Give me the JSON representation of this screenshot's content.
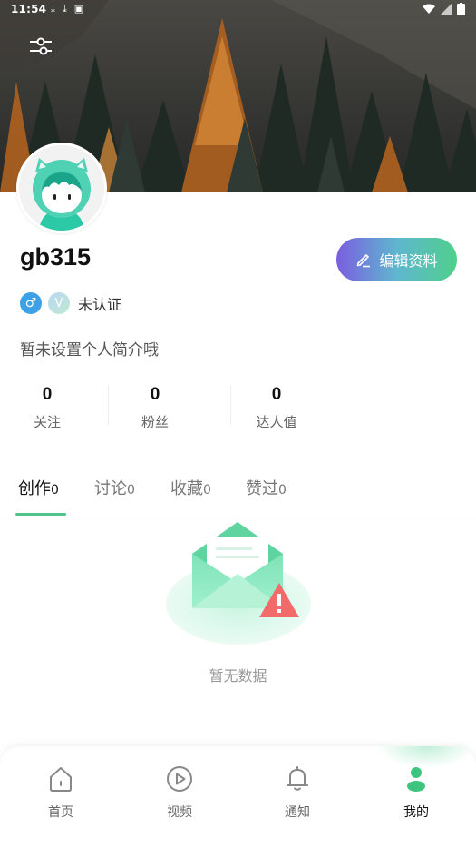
{
  "status_bar": {
    "time": "11:54"
  },
  "profile": {
    "username": "gb315",
    "gender_symbol": "♂",
    "verify_symbol": "V",
    "verify_status": "未认证",
    "bio": "暂未设置个人简介哦",
    "edit_button_label": "编辑资料"
  },
  "stats": [
    {
      "value": "0",
      "label": "关注"
    },
    {
      "value": "0",
      "label": "粉丝"
    },
    {
      "value": "0",
      "label": "达人值"
    }
  ],
  "tabs": [
    {
      "label": "创作",
      "count": "0",
      "active": true
    },
    {
      "label": "讨论",
      "count": "0",
      "active": false
    },
    {
      "label": "收藏",
      "count": "0",
      "active": false
    },
    {
      "label": "赞过",
      "count": "0",
      "active": false
    }
  ],
  "empty_state": {
    "text": "暂无数据"
  },
  "bottom_nav": [
    {
      "label": "首页",
      "icon": "home-icon"
    },
    {
      "label": "视频",
      "icon": "play-icon"
    },
    {
      "label": "通知",
      "icon": "bell-icon"
    },
    {
      "label": "我的",
      "icon": "user-icon",
      "active": true
    }
  ],
  "colors": {
    "accent_green": "#4fc38a",
    "gender_blue": "#3ea1e6",
    "edit_gradient_start": "#7a5ee0",
    "edit_gradient_end": "#4fd08c"
  }
}
